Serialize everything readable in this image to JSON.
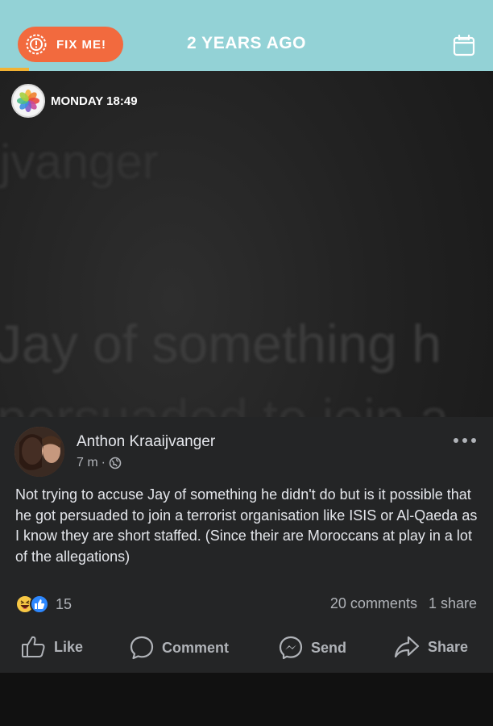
{
  "topbar": {
    "fix_label": "FIX ME!",
    "title": "2 YEARS AGO",
    "calendar_icon": "calendar-icon",
    "background_color": "#93d2d6",
    "fix_button_color": "#f26a3e"
  },
  "memory": {
    "timestamp": "MONDAY 18:49",
    "app_icon": "photos-app-icon",
    "background_text": {
      "line1": "jvanger",
      "line2": "Jay of something h",
      "line3": "persuaded to join a"
    }
  },
  "post": {
    "author": "Anthon Kraaijvanger",
    "time": "7 m",
    "separator": "·",
    "audience_icon": "globe-icon",
    "body": "Not trying to accuse Jay of something he didn't do but is it possible that he got persuaded to join a terrorist organisation like ISIS or Al-Qaeda as I know they are short staffed. (Since their are Moroccans at play in a lot of the allegations)",
    "reaction_count": "15",
    "comments": "20 comments",
    "shares": "1 share",
    "actions": {
      "like": "Like",
      "comment": "Comment",
      "send": "Send",
      "share": "Share"
    }
  }
}
